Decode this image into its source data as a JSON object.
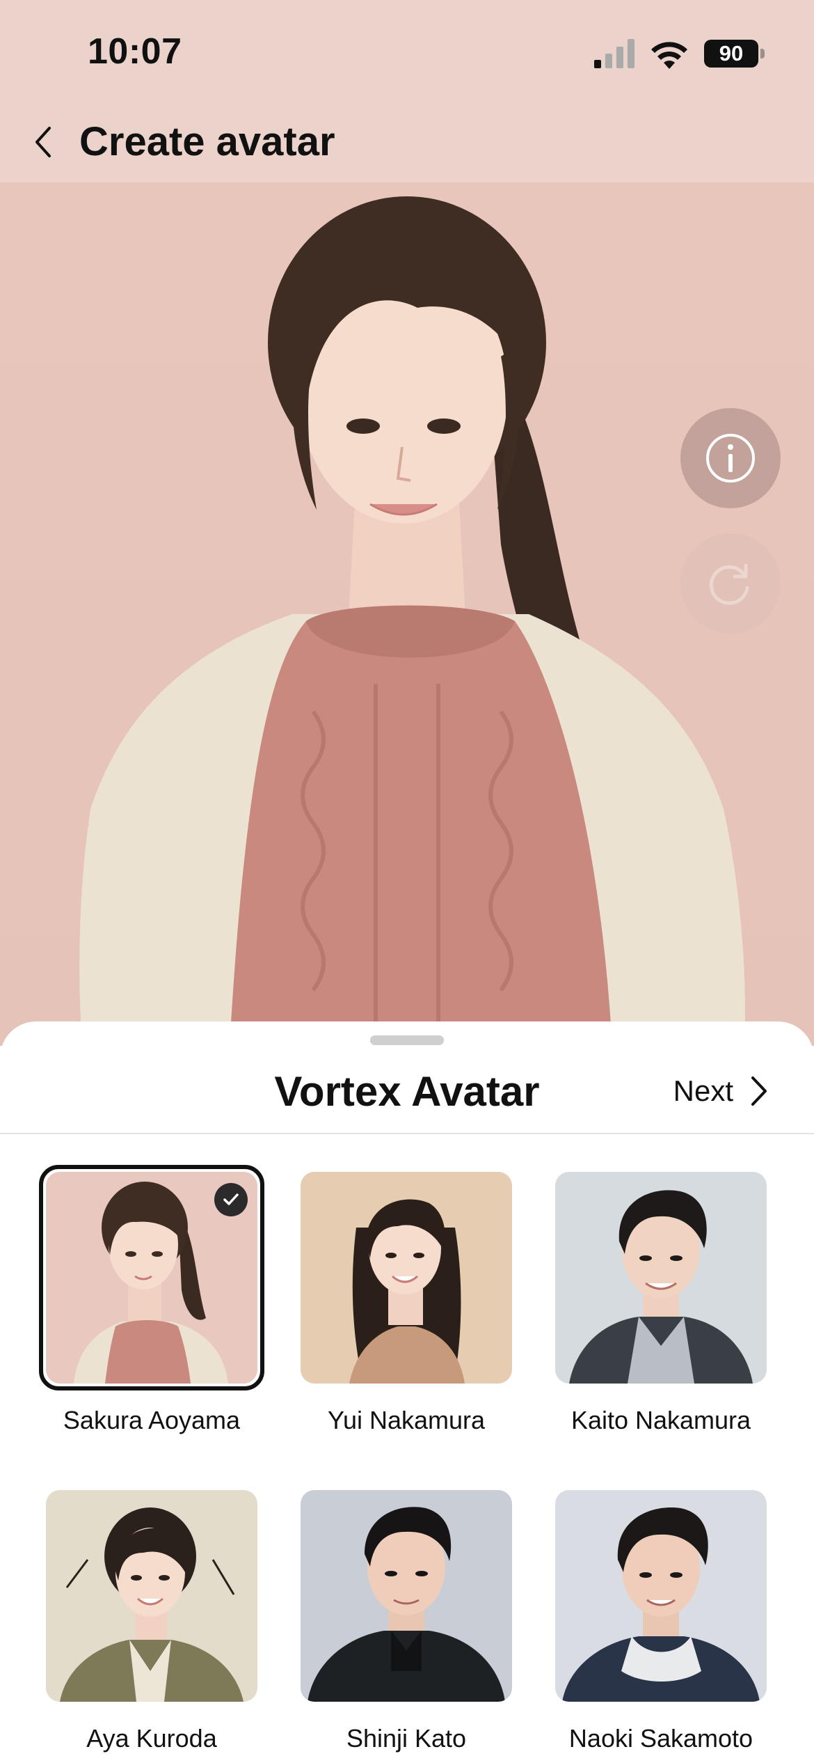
{
  "status_bar": {
    "time": "10:07",
    "battery": "90",
    "icons": [
      "signal-icon",
      "wifi-icon",
      "battery-icon"
    ]
  },
  "nav": {
    "back_icon": "chevron-left-icon",
    "title": "Create avatar"
  },
  "preview": {
    "info_icon": "info-icon",
    "regenerate_icon": "refresh-icon"
  },
  "sheet": {
    "title": "Vortex Avatar",
    "next_label": "Next",
    "next_icon": "chevron-right-icon"
  },
  "avatars": [
    {
      "name": "Sakura Aoyama",
      "selected": true,
      "bg": "#e9c8bf"
    },
    {
      "name": "Yui Nakamura",
      "selected": false,
      "bg": "#e6cdb1"
    },
    {
      "name": "Kaito Nakamura",
      "selected": false,
      "bg": "#d6dbe0"
    },
    {
      "name": "Aya Kuroda",
      "selected": false,
      "bg": "#e3dccb"
    },
    {
      "name": "Shinji Kato",
      "selected": false,
      "bg": "#c9ced6"
    },
    {
      "name": "Naoki Sakamoto",
      "selected": false,
      "bg": "#d9dde3"
    }
  ],
  "colors": {
    "header_bg": "#ebd3cb",
    "preview_bg": "#e9c8bf",
    "selected_border": "#111111"
  }
}
